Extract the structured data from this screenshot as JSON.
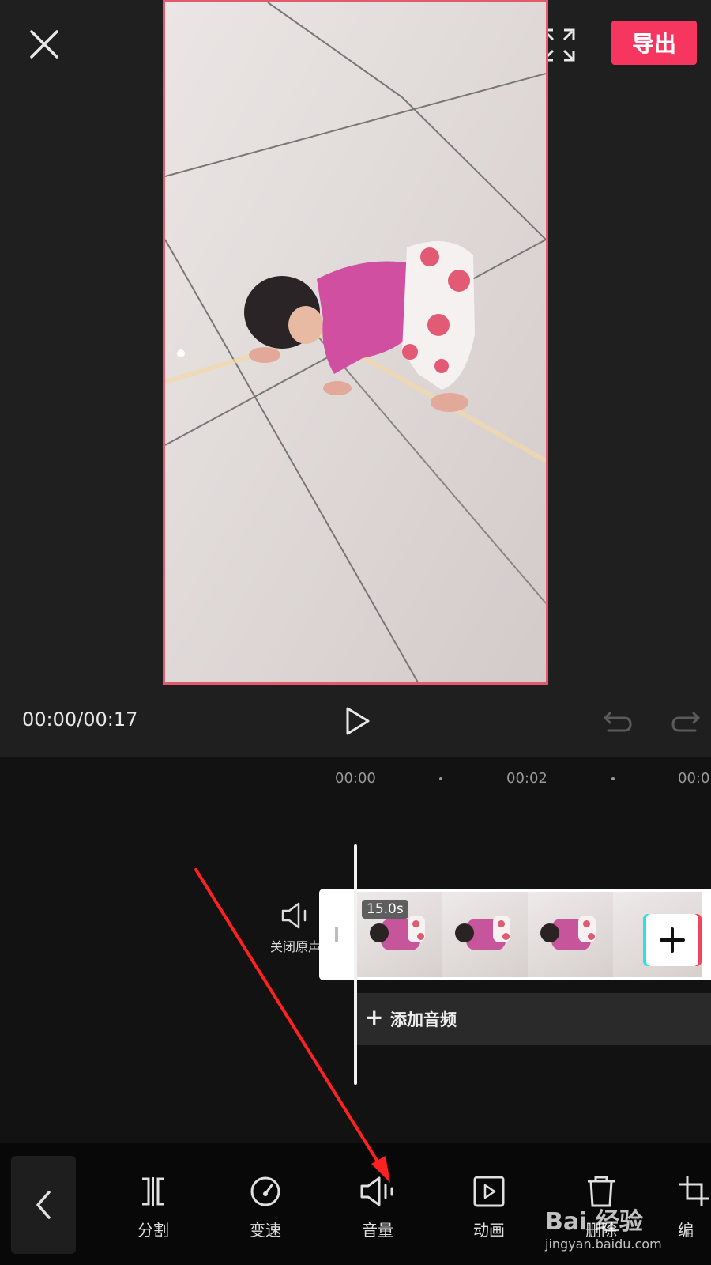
{
  "top_bar": {
    "close_icon": "close-icon",
    "fullscreen_icon": "fullscreen-icon",
    "export_label": "导出",
    "accent_color": "#f6365f"
  },
  "playback": {
    "time": "00:00/00:17",
    "play_icon": "play-icon",
    "undo_icon": "undo-icon",
    "redo_icon": "redo-icon"
  },
  "timeline": {
    "ruler_labels": [
      "00:00",
      "00:02",
      "00:0"
    ],
    "mute_label": "关闭原声",
    "clip_duration": "15.0s",
    "add_audio_label": "添加音频",
    "add_audio_icon": "+"
  },
  "toolbar": {
    "back_icon": "chevron-left-icon",
    "tools": [
      {
        "label": "分割",
        "icon": "split-icon"
      },
      {
        "label": "变速",
        "icon": "speed-icon"
      },
      {
        "label": "音量",
        "icon": "volume-icon"
      },
      {
        "label": "动画",
        "icon": "animation-icon"
      },
      {
        "label": "删除",
        "icon": "delete-icon"
      },
      {
        "label": "编",
        "icon": "edit-icon"
      }
    ]
  },
  "watermark": {
    "brand": "Bai 经验",
    "url": "jingyan.baidu.com"
  }
}
